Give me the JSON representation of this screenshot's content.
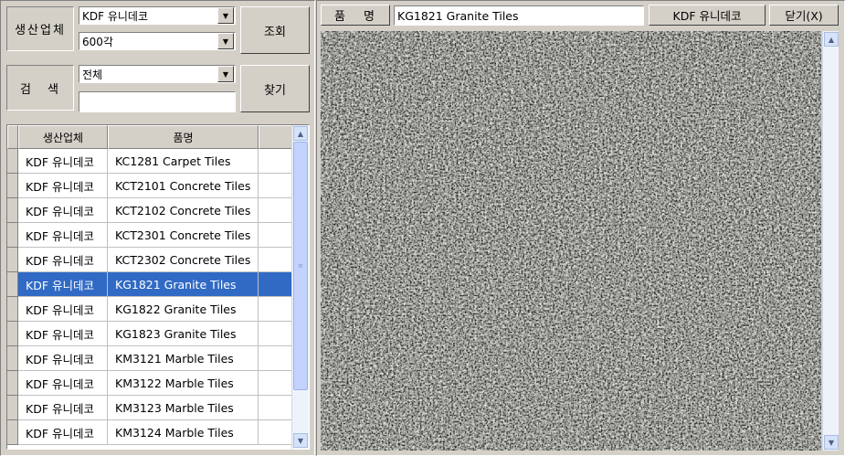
{
  "filter": {
    "manufacturer_label": "생산업체",
    "manufacturer_value": "KDF 유니데코",
    "size_value": "600각",
    "query_button": "조회",
    "search_label": "검 색",
    "search_category_value": "전체",
    "search_text_value": "",
    "find_button": "찾기"
  },
  "grid": {
    "columns": [
      "생산업체",
      "품명"
    ],
    "rows": [
      {
        "maker": "KDF 유니데코",
        "name": "KC1281 Carpet Tiles"
      },
      {
        "maker": "KDF 유니데코",
        "name": "KCT2101 Concrete Tiles"
      },
      {
        "maker": "KDF 유니데코",
        "name": "KCT2102 Concrete Tiles"
      },
      {
        "maker": "KDF 유니데코",
        "name": "KCT2301 Concrete Tiles"
      },
      {
        "maker": "KDF 유니데코",
        "name": "KCT2302 Concrete Tiles"
      },
      {
        "maker": "KDF 유니데코",
        "name": "KG1821 Granite Tiles"
      },
      {
        "maker": "KDF 유니데코",
        "name": "KG1822 Granite Tiles"
      },
      {
        "maker": "KDF 유니데코",
        "name": "KG1823 Granite Tiles"
      },
      {
        "maker": "KDF 유니데코",
        "name": "KM3121 Marble Tiles"
      },
      {
        "maker": "KDF 유니데코",
        "name": "KM3122 Marble Tiles"
      },
      {
        "maker": "KDF 유니데코",
        "name": "KM3123 Marble Tiles"
      },
      {
        "maker": "KDF 유니데코",
        "name": "KM3124 Marble Tiles"
      }
    ],
    "selected_index": 5
  },
  "detail": {
    "name_label": "품 명",
    "name_value": "KG1821 Granite Tiles",
    "maker_value": "KDF 유니데코",
    "close_button": "닫기(X)"
  },
  "icons": {
    "dropdown": "chevron-down-icon",
    "scroll_up": "chevron-up-icon",
    "scroll_down": "chevron-down-icon",
    "grip": "grip-icon"
  },
  "colors": {
    "selection": "#316ac5",
    "face": "#d4d0c8"
  }
}
